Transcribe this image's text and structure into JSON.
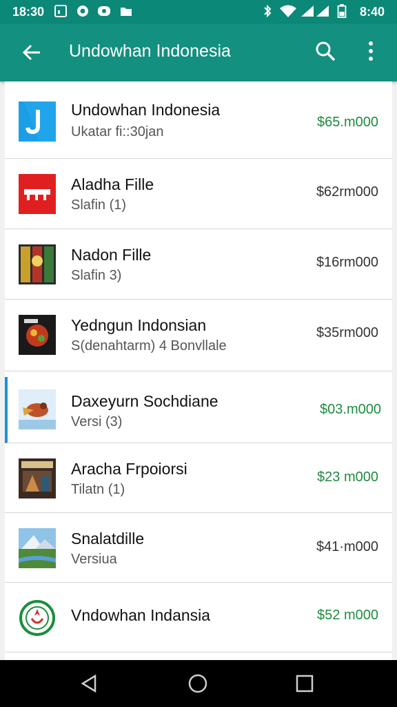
{
  "status_bar": {
    "time_left": "18:30",
    "time_right": "8:40"
  },
  "app_bar": {
    "title": "Undowhan Indonesia"
  },
  "items": [
    {
      "name": "Undowhan Indonesia",
      "subtitle": "Ukatar fi::30jan",
      "price": "$65.m000",
      "price_color": "#1b8d3c"
    },
    {
      "name": "Aladha Fille",
      "subtitle": "Slafin (1)",
      "price": "$62rm000",
      "price_color": "#333333"
    },
    {
      "name": "Nadon Fille",
      "subtitle": "Slafin 3)",
      "price": "$16rm000",
      "price_color": "#333333"
    },
    {
      "name": "Yedngun Indonsian",
      "subtitle": "S(denahtarm) 4 Bonvllale",
      "price": "$35rm000",
      "price_color": "#333333"
    },
    {
      "name": "Daxeyurn Sochdiane",
      "subtitle": "Versi (3)",
      "price": "$03.m000",
      "price_color": "#1b8d3c"
    },
    {
      "name": "Aracha Frpoiorsi",
      "subtitle": "Tilatn (1)",
      "price": "$23 m000",
      "price_color": "#1b8d3c"
    },
    {
      "name": "Snalatdille",
      "subtitle": "Versiua",
      "price": "$41·m000",
      "price_color": "#333333"
    },
    {
      "name": "Vndowhan Indansia",
      "subtitle": "",
      "price": "$52 m000",
      "price_color": "#1b8d3c"
    }
  ]
}
